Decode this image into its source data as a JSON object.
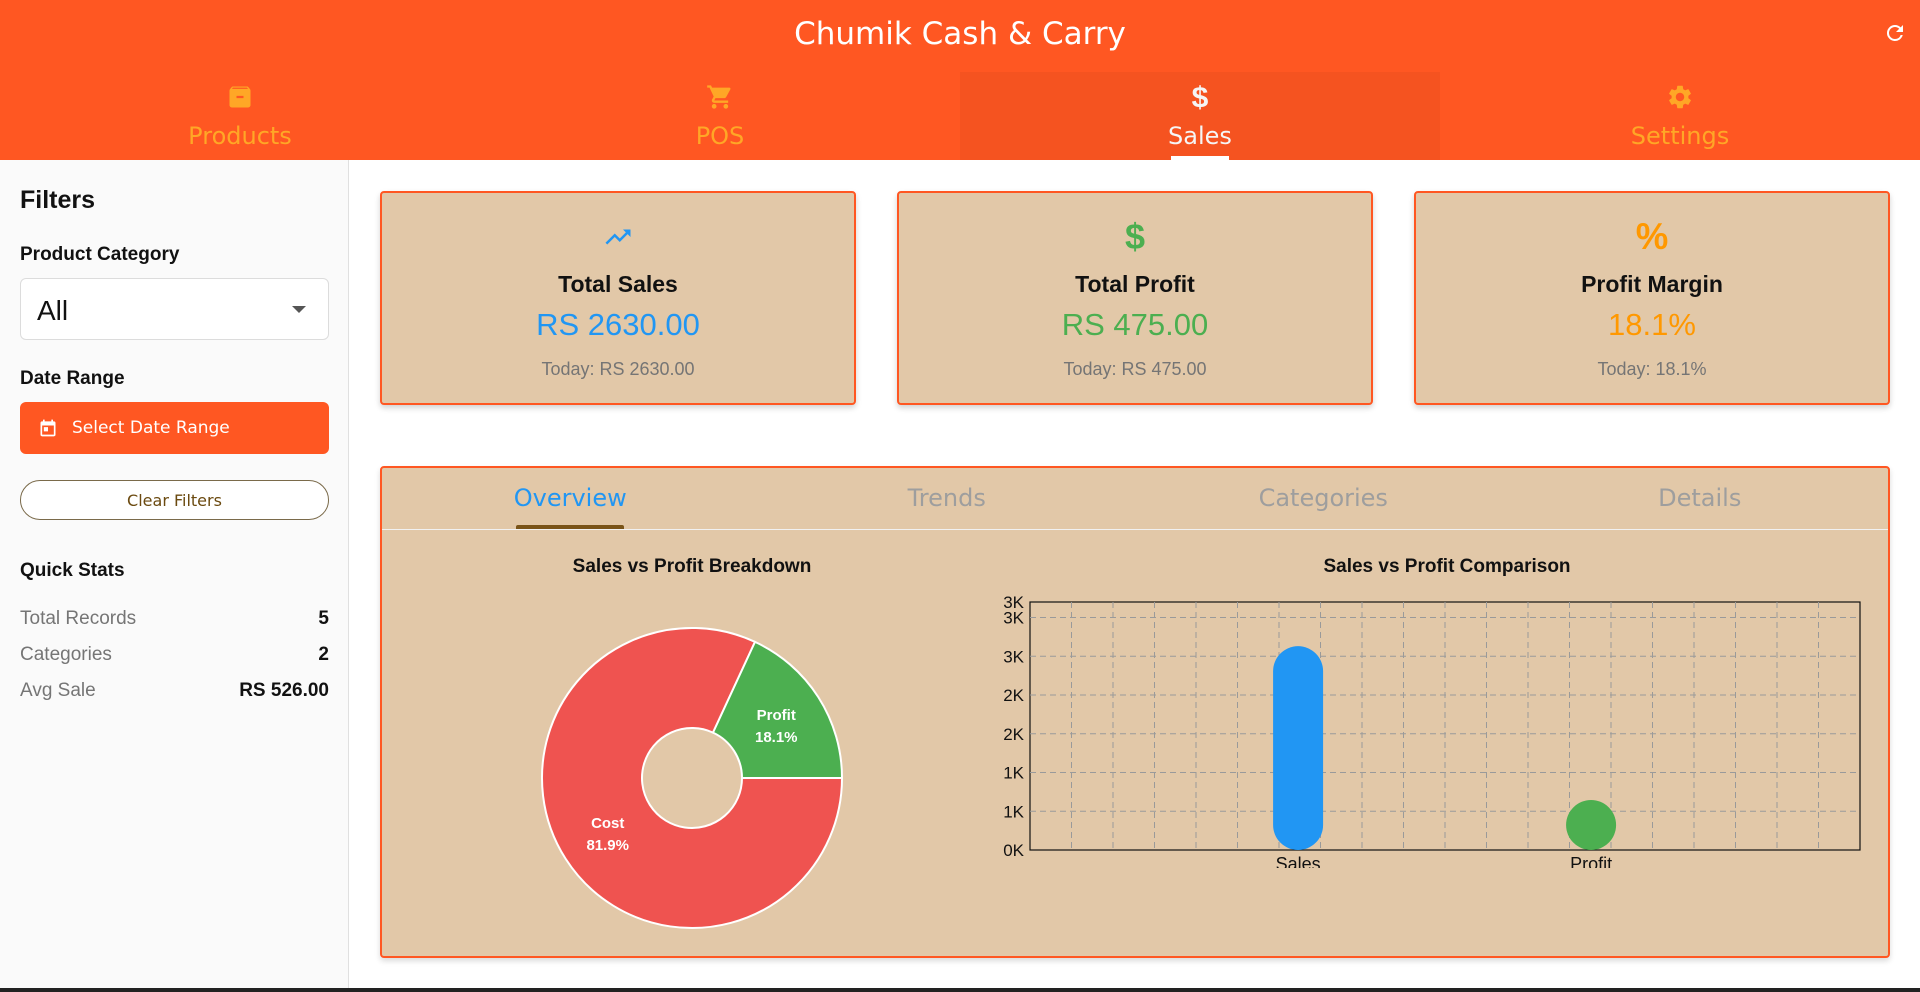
{
  "header": {
    "title": "Chumik Cash & Carry",
    "tabs": [
      {
        "label": "Products",
        "icon": "archive-icon",
        "active": false
      },
      {
        "label": "POS",
        "icon": "cart-icon",
        "active": false
      },
      {
        "label": "Sales",
        "icon": "dollar-icon",
        "active": true
      },
      {
        "label": "Settings",
        "icon": "gear-icon",
        "active": false
      }
    ],
    "refresh_icon": "refresh-icon"
  },
  "sidebar": {
    "title": "Filters",
    "category_label": "Product Category",
    "category_value": "All",
    "date_label": "Date Range",
    "date_button": "Select Date Range",
    "clear_button": "Clear Filters",
    "quick_stats_title": "Quick Stats",
    "stats": [
      {
        "name": "Total Records",
        "value": "5"
      },
      {
        "name": "Categories",
        "value": "2"
      },
      {
        "name": "Avg Sale",
        "value": "RS 526.00"
      }
    ]
  },
  "cards": [
    {
      "icon": "trending-up-icon",
      "title": "Total Sales",
      "value": "RS 2630.00",
      "today": "Today: RS 2630.00",
      "color": "#2196f3"
    },
    {
      "icon": "dollar-icon",
      "title": "Total Profit",
      "value": "RS 475.00",
      "today": "Today: RS 475.00",
      "color": "#4caf50"
    },
    {
      "icon": "percent-icon",
      "title": "Profit Margin",
      "value": "18.1%",
      "today": "Today: 18.1%",
      "color": "#ff9800"
    }
  ],
  "panel": {
    "tabs": [
      {
        "label": "Overview",
        "active": true
      },
      {
        "label": "Trends",
        "active": false
      },
      {
        "label": "Categories",
        "active": false
      },
      {
        "label": "Details",
        "active": false
      }
    ]
  },
  "colors": {
    "brand": "#ff5722",
    "card_bg": "#e2c8a8",
    "sales": "#2196f3",
    "profit": "#4caf50",
    "cost": "#ef5350",
    "margin": "#ff9800"
  },
  "chart_data": [
    {
      "type": "pie",
      "title": "Sales vs Profit Breakdown",
      "donut": true,
      "slices": [
        {
          "label": "Cost",
          "value": 81.9,
          "display": "81.9%"
        },
        {
          "label": "Profit",
          "value": 18.1,
          "display": "18.1%"
        }
      ]
    },
    {
      "type": "bar",
      "title": "Sales vs Profit Comparison",
      "categories": [
        "Sales",
        "Profit"
      ],
      "values": [
        2630,
        475
      ],
      "ylim": [
        0,
        3200
      ],
      "y_ticks": [
        {
          "value": 0,
          "label": "0K"
        },
        {
          "value": 500,
          "label": "1K"
        },
        {
          "value": 1000,
          "label": "1K"
        },
        {
          "value": 1500,
          "label": "2K"
        },
        {
          "value": 2000,
          "label": "2K"
        },
        {
          "value": 2500,
          "label": "3K"
        },
        {
          "value": 3000,
          "label": "3K"
        },
        {
          "value": 3200,
          "label": "3K"
        }
      ],
      "grid": true
    }
  ]
}
